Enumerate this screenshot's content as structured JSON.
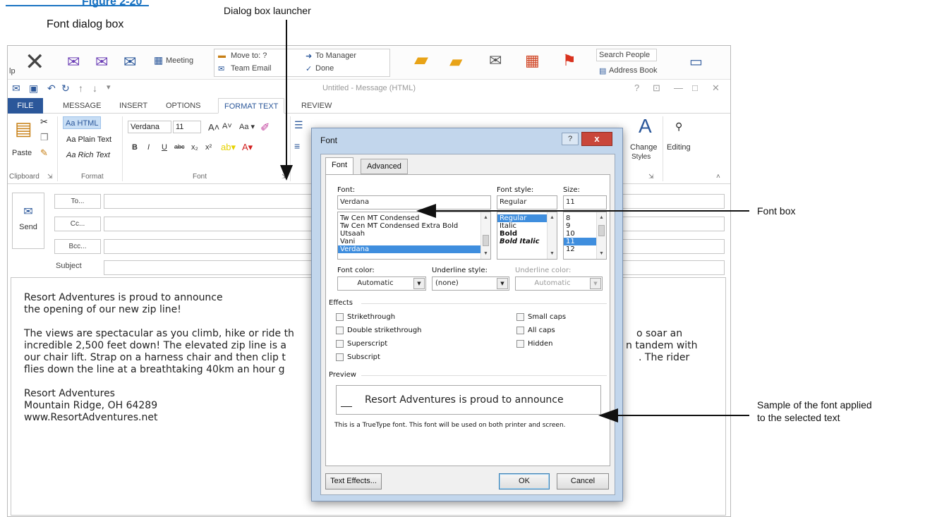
{
  "figure": {
    "number": "Figure 2-20",
    "caption": "Font dialog box",
    "callouts": {
      "launcher": "Dialog box launcher",
      "font_box": "Font box",
      "sample_line1": "Sample of the font applied",
      "sample_line2": "to the selected text"
    }
  },
  "quicksteps": {
    "meeting": "Meeting",
    "move_to": "Move to: ?",
    "team_email": "Team Email",
    "to_manager": "To Manager",
    "done": "Done",
    "search_people": "Search People",
    "address_book": "Address Book",
    "partial_left": "lp"
  },
  "window": {
    "title": "Untitled - Message (HTML)",
    "help": "?",
    "restore": "⊡",
    "minimize": "—",
    "maximize": "□",
    "close": "✕"
  },
  "ribbon_tabs": [
    "FILE",
    "MESSAGE",
    "INSERT",
    "OPTIONS",
    "FORMAT TEXT",
    "REVIEW"
  ],
  "ribbon": {
    "paste": "Paste",
    "clipboard": "Clipboard",
    "format_html": "Aa HTML",
    "format_plain": "Aa Plain Text",
    "format_rich": "Aa Rich Text",
    "format_group": "Format",
    "font_name": "Verdana",
    "font_size": "11",
    "font_group": "Font",
    "change_styles": "Change",
    "styles": "Styles",
    "editing": "Editing",
    "format_buttons": [
      "B",
      "I",
      "U",
      "abc",
      "x₂",
      "x²"
    ]
  },
  "compose": {
    "send": "Send",
    "to": "To...",
    "cc": "Cc...",
    "bcc": "Bcc...",
    "subject": "Subject"
  },
  "message": {
    "line1": "Resort Adventures is proud to announce",
    "line2": "the opening of our new zip line!",
    "para_line1": "The views are spectacular as you climb, hike or ride th",
    "para_line1_end": "o soar an",
    "para_line2": "incredible 2,500 feet down! The elevated zip line is a",
    "para_line2_end": "n tandem with",
    "para_line3": "our chair lift.  Strap on a harness chair and then clip t",
    "para_line3_end": ". The rider",
    "para_line4": "flies down the line at a breathtaking 40km an hour g",
    "sig1": "Resort Adventures",
    "sig2": "Mountain Ridge, OH 64289",
    "sig3": "www.ResortAdventures.net"
  },
  "dialog": {
    "title": "Font",
    "help": "?",
    "close": "x",
    "tab_font": "Font",
    "tab_advanced": "Advanced",
    "font_label": "Font:",
    "font_value": "Verdana",
    "font_list": [
      "Tw Cen MT Condensed",
      "Tw Cen MT Condensed Extra Bold",
      "Utsaah",
      "Vani",
      "Verdana"
    ],
    "style_label": "Font style:",
    "style_value": "Regular",
    "style_list": [
      "Regular",
      "Italic",
      "Bold",
      "Bold Italic"
    ],
    "size_label": "Size:",
    "size_value": "11",
    "size_list": [
      "8",
      "9",
      "10",
      "11",
      "12"
    ],
    "font_color_label": "Font color:",
    "font_color_value": "Automatic",
    "underline_style_label": "Underline style:",
    "underline_style_value": "(none)",
    "underline_color_label": "Underline color:",
    "underline_color_value": "Automatic",
    "effects_label": "Effects",
    "effects_left": [
      "Strikethrough",
      "Double strikethrough",
      "Superscript",
      "Subscript"
    ],
    "effects_right": [
      "Small caps",
      "All caps",
      "Hidden"
    ],
    "preview_label": "Preview",
    "preview_text": "Resort Adventures is proud to announce",
    "truetype_note": "This is a TrueType font. This font will be used on both printer and screen.",
    "text_effects": "Text Effects...",
    "ok": "OK",
    "cancel": "Cancel"
  }
}
